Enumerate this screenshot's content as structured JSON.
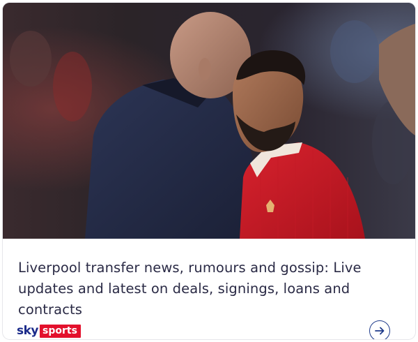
{
  "article": {
    "headline": "Liverpool transfer news, rumours and gossip: Live updates and latest on deals, signings, loans and contracts",
    "image_icon": "photo-icon"
  },
  "brand": {
    "sky": "sky",
    "sports": "sports",
    "colors": {
      "sky": "#1a2a8a",
      "sports_bg": "#e3102c"
    }
  },
  "actions": {
    "open_icon": "arrow-right-circle-icon",
    "accent": "#1e3a8a"
  }
}
